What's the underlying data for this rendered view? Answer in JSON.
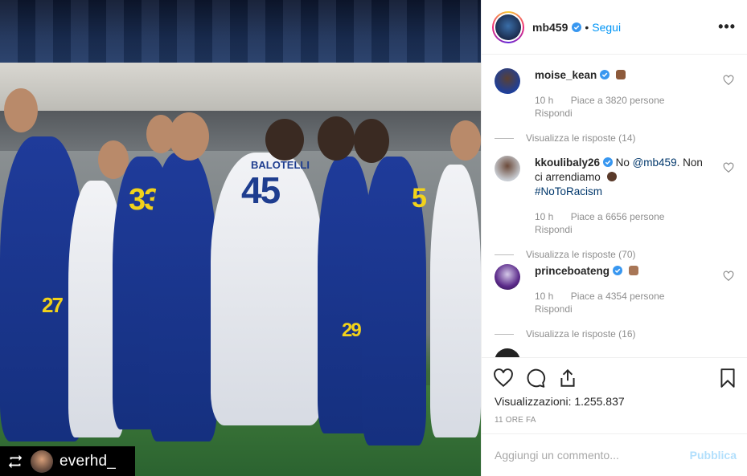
{
  "media": {
    "repost_user": "everhd_",
    "jersey_number_center": "45",
    "jersey_name_center": "BALOTELLI",
    "jersey_numbers_other": [
      "33",
      "27",
      "29",
      "5"
    ]
  },
  "header": {
    "username": "mb459",
    "separator": "•",
    "follow_label": "Segui",
    "more_label": "•••"
  },
  "comments": [
    {
      "username": "moise_kean",
      "text": "",
      "time": "10 h",
      "likes": "Piace a 3820 persone",
      "reply": "Rispondi",
      "thread": "Visualizza le risposte (14)"
    },
    {
      "username": "kkoulibaly26",
      "text_pre": "No ",
      "mention": "@mb459",
      "text_mid": ". Non ci arrendiamo",
      "hashtag": "#NoToRacism",
      "time": "10 h",
      "likes": "Piace a 6656 persone",
      "reply": "Rispondi",
      "thread": "Visualizza le risposte (70)"
    },
    {
      "username": "princeboateng",
      "text": "",
      "time": "10 h",
      "likes": "Piace a 4354 persone",
      "reply": "Rispondi",
      "thread": "Visualizza le risposte (16)"
    }
  ],
  "stats": {
    "views_label": "Visualizzazioni:",
    "views_value": "1.255.837",
    "time_ago": "11 ORE FA"
  },
  "composer": {
    "placeholder": "Aggiungi un commento...",
    "post_label": "Pubblica"
  },
  "colors": {
    "accent": "#0095f6",
    "verified": "#3897f0",
    "muted": "#8e8e8e",
    "hashtag": "#00376b"
  }
}
